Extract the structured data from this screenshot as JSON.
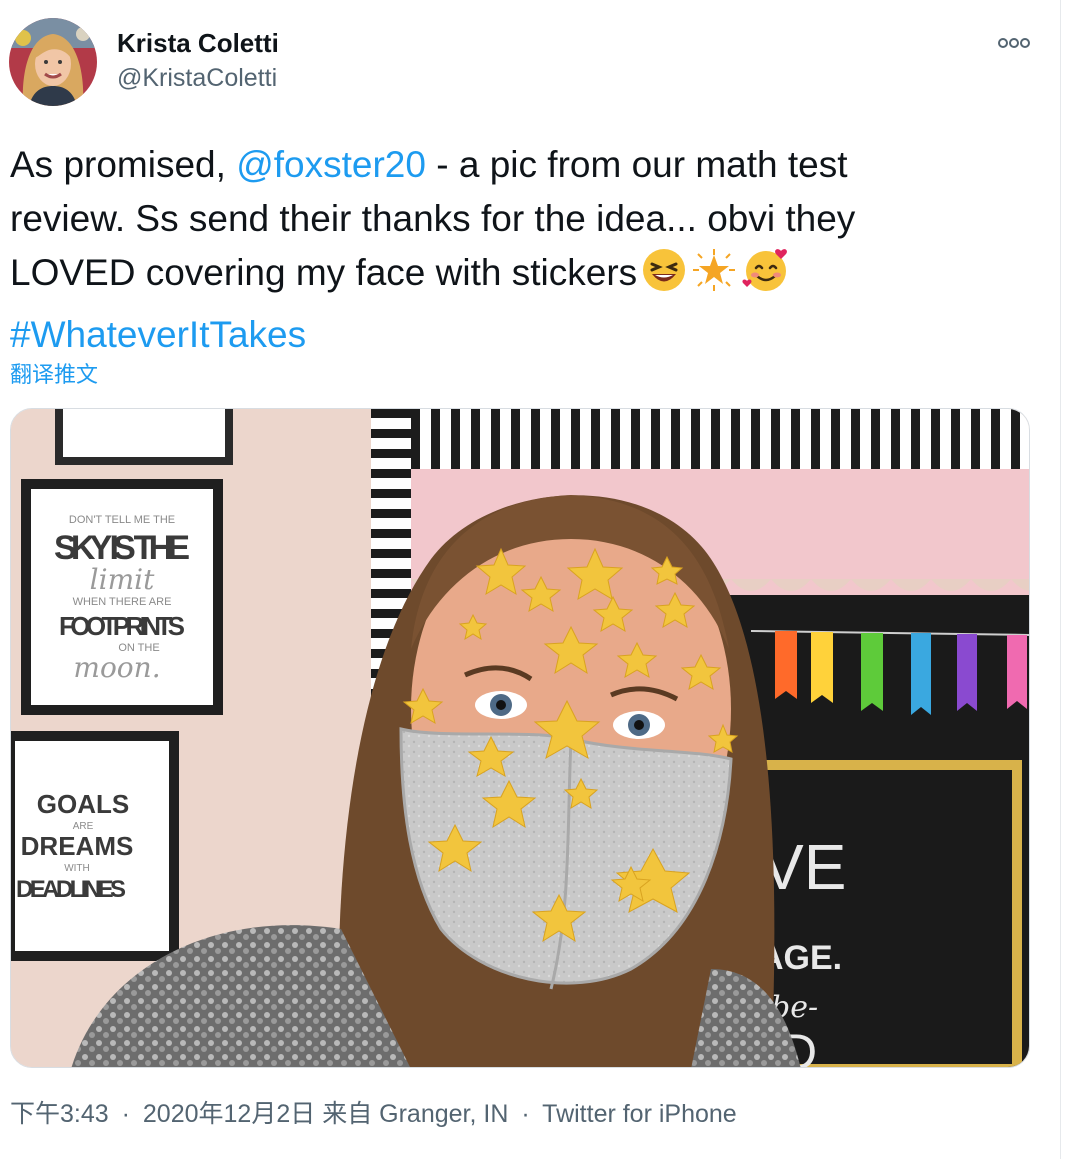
{
  "author": {
    "name": "Krista Coletti",
    "handle": "@KristaColetti",
    "avatar_icon": "profile-photo"
  },
  "tweet": {
    "line1_prefix": "As promised, ",
    "mention": "@foxster20",
    "line1_suffix": " - a pic from our math test",
    "line2": "review. Ss send their thanks for the idea... obvi they",
    "line3": "LOVED covering my face with stickers",
    "emojis": [
      "laughing-face-emoji",
      "star-emoji",
      "smiling-face-with-hearts-emoji"
    ],
    "hashtag": "#WhateverItTakes",
    "translate_label": "翻译推文"
  },
  "photo": {
    "poster1_line1": "DON'T TELL ME THE",
    "poster1_line2": "SKY IS THE",
    "poster1_line3": "limit",
    "poster1_line4": "WHEN THERE ARE",
    "poster1_line5": "FOOTPRINTS",
    "poster1_line6": "ON THE",
    "poster1_line7": "moon.",
    "poster2_line1": "GOALS",
    "poster2_line2": "ARE",
    "poster2_line3": "DREAMS",
    "poster2_line4": "WITH",
    "poster2_line5": "DEADLINES",
    "board_line1": "VE",
    "board_line2": "AGE.",
    "board_line3": "be-",
    "board_line4": "D"
  },
  "meta": {
    "time": "下午3:43",
    "date": "2020年12月2日",
    "location_prefix": "来自",
    "location": "Granger, IN",
    "source": "Twitter for iPhone",
    "separator": "·"
  },
  "colors": {
    "link": "#1d9bf0",
    "secondary_text": "#536471",
    "primary_text": "#0f1419"
  }
}
